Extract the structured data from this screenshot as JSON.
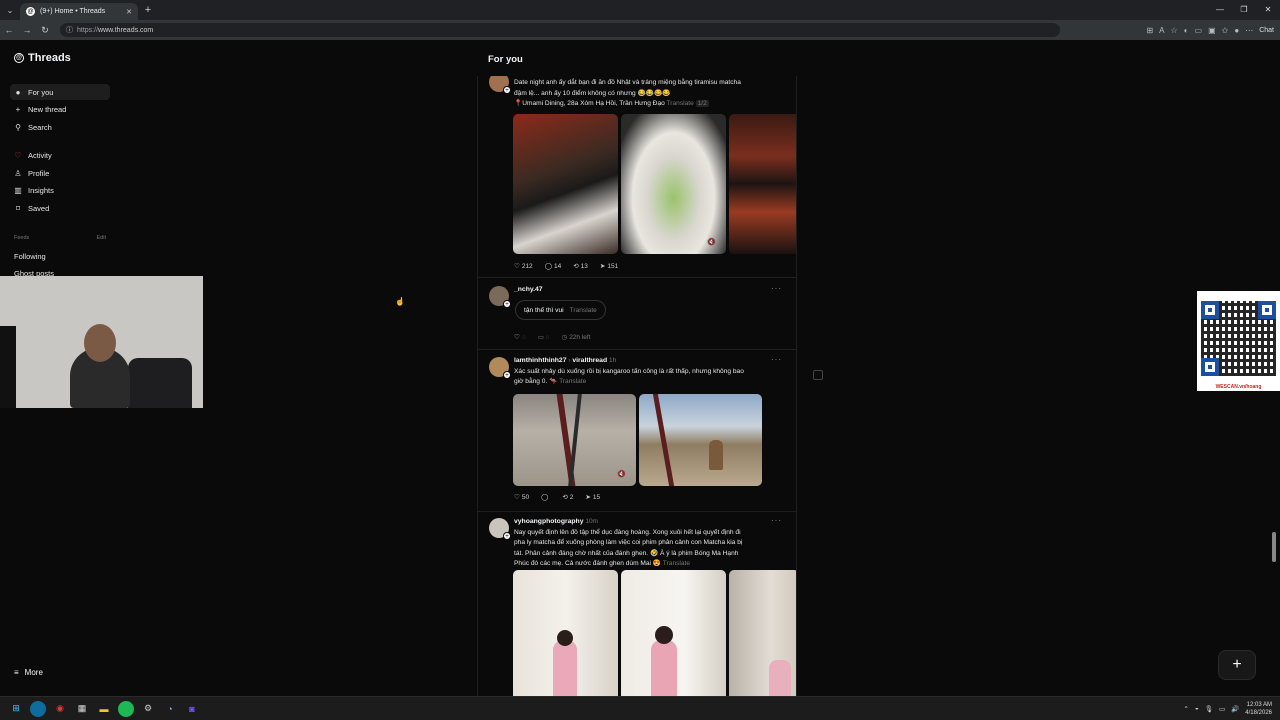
{
  "browser": {
    "tab_title": "(9+) Home • Threads",
    "url_scheme": "https://",
    "url_host": "www.threads.com",
    "chat_label": "Chat"
  },
  "sidebar": {
    "brand": "Threads",
    "nav": [
      {
        "label": "For you",
        "icon": "home-icon"
      },
      {
        "label": "New thread",
        "icon": "plus-icon"
      },
      {
        "label": "Search",
        "icon": "search-icon"
      },
      {
        "label": "Activity",
        "icon": "heart-icon"
      },
      {
        "label": "Profile",
        "icon": "person-icon"
      },
      {
        "label": "Insights",
        "icon": "chart-icon"
      },
      {
        "label": "Saved",
        "icon": "bookmark-icon"
      }
    ],
    "feeds_label": "Feeds",
    "edit_label": "Edit",
    "following": "Following",
    "ghost_posts": "Ghost posts",
    "more": "More"
  },
  "feed": {
    "title": "For you",
    "posts": [
      {
        "text1": "Date night anh ấy dắt bạn đi ăn đồ Nhật và tráng miệng bằng tiramisu matcha",
        "text2": "đậm lệ... anh ấy 10 điểm không có nhưng 😂😂😂😂",
        "location": "📍Umami Dining, 28a Xóm Hạ Hồi, Trần Hưng Đạo",
        "translate": "Translate",
        "page": "1/2",
        "likes": "212",
        "comments": "14",
        "reposts": "13",
        "shares": "151"
      },
      {
        "username": "_nchy.47",
        "bubble_text": "tận thế thì vui",
        "translate": "Translate",
        "time_left": "22h left"
      },
      {
        "username": "lamthinhthinh27",
        "via": "viralthread",
        "time": "1h",
        "text1": "Xác suất nhảy dù xuống rồi bị kangaroo tấn công là rất thấp, nhưng không bao",
        "text2": "giờ bằng 0. 🦘",
        "translate": "Translate",
        "likes": "50",
        "reposts": "2",
        "shares": "15"
      },
      {
        "username": "vyhoangphotography",
        "time": "10m",
        "text1": "Nay quyết định lên đồ tập thể dục đàng hoàng. Xong xuôi hết lại quyết định đi",
        "text2": "pha ly matcha để xuống phòng làm việc coi phim phân cảnh con Matcha kia bị",
        "text3": "tát. Phân cảnh đáng chờ nhất của đánh ghen. 🤣 À ý là phim Bóng Ma Hạnh",
        "text4": "Phúc đó các mẹ. Cả nước đánh ghen dùm Mai 😍",
        "translate": "Translate"
      }
    ]
  },
  "overlay": {
    "qr_caption": "WESCAN.vn/hoang"
  },
  "taskbar": {
    "time": "12:03 AM",
    "date": "4/18/2026"
  }
}
